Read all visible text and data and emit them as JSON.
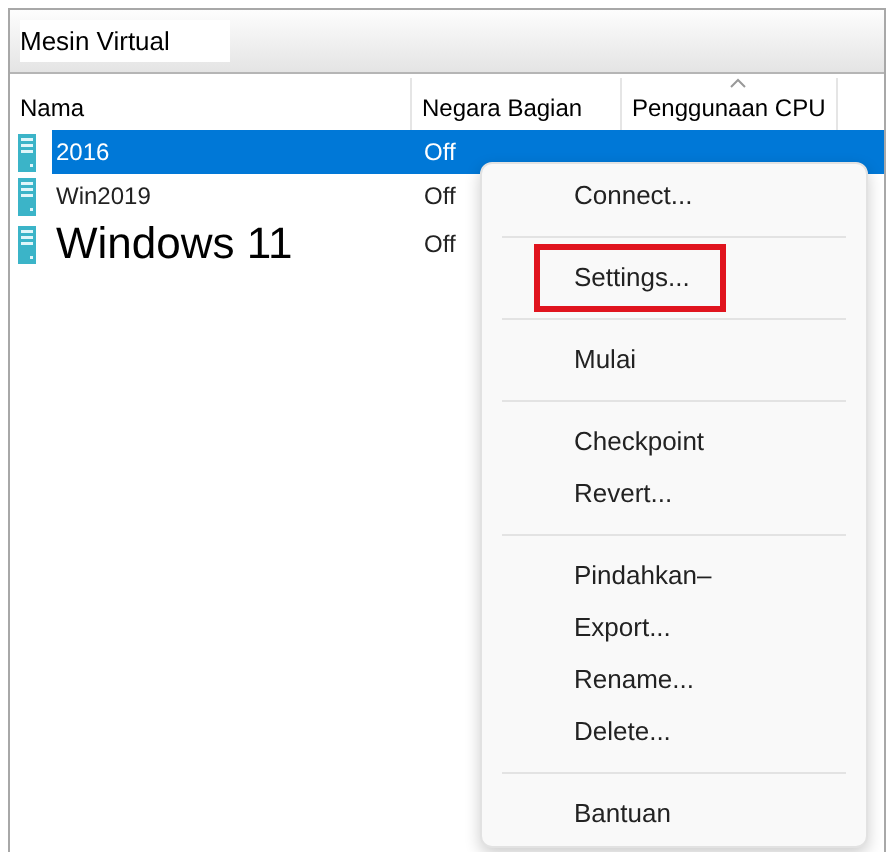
{
  "panel": {
    "title": "Mesin Virtual"
  },
  "table": {
    "columns": [
      {
        "label": "Nama",
        "sorted": false
      },
      {
        "label": "Negara Bagian",
        "sorted": false
      },
      {
        "label": "Penggunaan CPU",
        "sorted": true
      }
    ],
    "rows": [
      {
        "name": "2016",
        "state": "Off",
        "selected": true,
        "large": false
      },
      {
        "name": "Win2019",
        "state": "Off",
        "selected": false,
        "large": false
      },
      {
        "name": "Windows 11",
        "state": "Off",
        "selected": false,
        "large": true
      }
    ]
  },
  "context_menu": {
    "groups": [
      [
        {
          "label": "Connect...",
          "outlined": false
        }
      ],
      [
        {
          "label": "Settings...",
          "outlined": true
        }
      ],
      [
        {
          "label": "Mulai",
          "outlined": false
        }
      ],
      [
        {
          "label": "Checkpoint",
          "outlined": false
        },
        {
          "label": "Revert...",
          "outlined": false
        }
      ],
      [
        {
          "label": "Pindahkan–",
          "outlined": false
        },
        {
          "label": "Export...",
          "outlined": false
        },
        {
          "label": "Rename...",
          "outlined": false
        },
        {
          "label": "Delete...",
          "outlined": false
        }
      ],
      [
        {
          "label": "Bantuan",
          "outlined": false
        }
      ]
    ]
  }
}
